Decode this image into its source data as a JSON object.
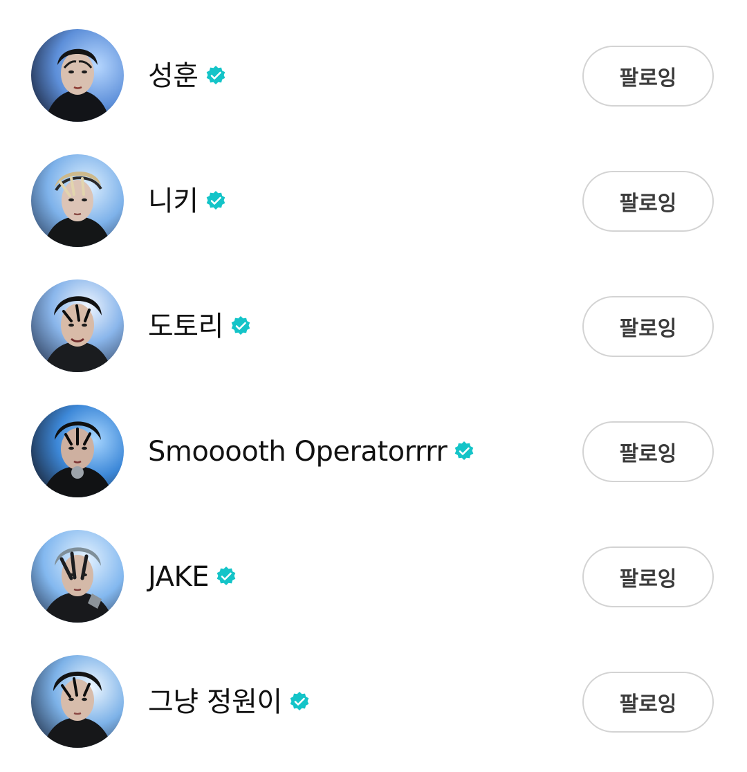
{
  "accent_color": "#14C4C8",
  "following": [
    {
      "name": "성훈",
      "verified_icon": "verified-badge-icon",
      "button_label": "팔로잉"
    },
    {
      "name": "니키",
      "verified_icon": "verified-badge-icon",
      "button_label": "팔로잉"
    },
    {
      "name": "도토리",
      "verified_icon": "verified-badge-icon",
      "button_label": "팔로잉"
    },
    {
      "name": "Smooooth Operatorrrr",
      "verified_icon": "verified-badge-icon",
      "button_label": "팔로잉"
    },
    {
      "name": "JAKE",
      "verified_icon": "verified-badge-icon",
      "button_label": "팔로잉"
    },
    {
      "name": "그냥 정원이",
      "verified_icon": "verified-badge-icon",
      "button_label": "팔로잉"
    }
  ]
}
